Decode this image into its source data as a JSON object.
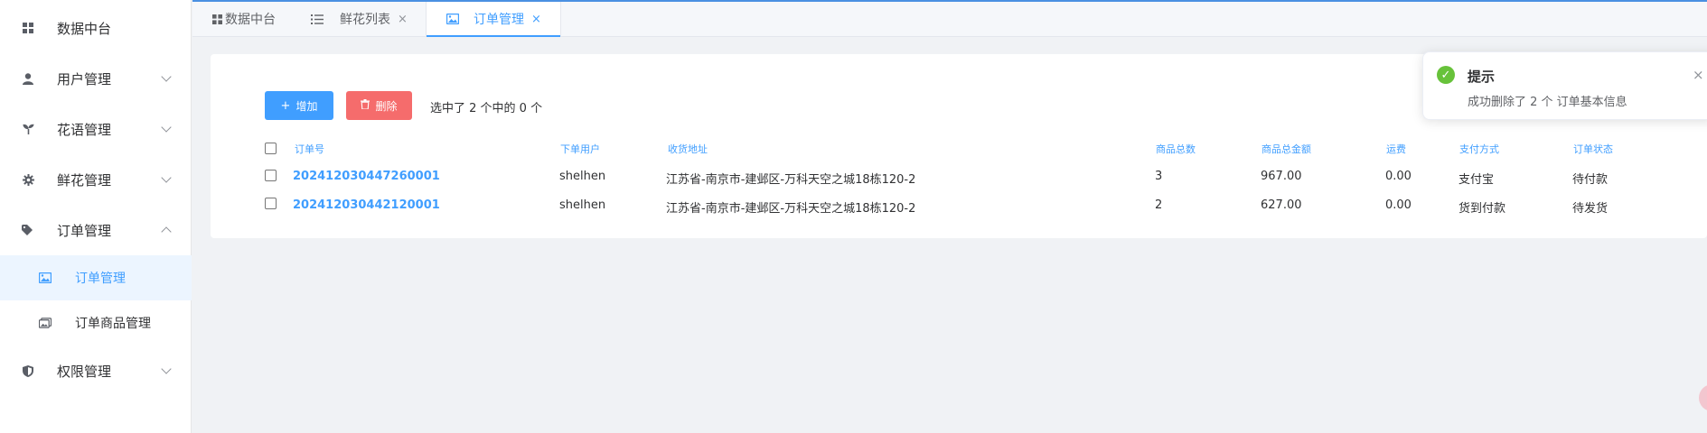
{
  "sidebar": {
    "items": [
      {
        "label": "数据中台",
        "icon": "grid-icon"
      },
      {
        "label": "用户管理",
        "icon": "user-icon"
      },
      {
        "label": "花语管理",
        "icon": "sprout-icon"
      },
      {
        "label": "鲜花管理",
        "icon": "gear-icon"
      },
      {
        "label": "订单管理",
        "icon": "tag-icon"
      },
      {
        "label": "权限管理",
        "icon": "shield-icon"
      }
    ],
    "sub_items": [
      {
        "label": "订单管理",
        "icon": "picture-icon"
      },
      {
        "label": "订单商品管理",
        "icon": "pictures-icon"
      }
    ]
  },
  "tabs": [
    {
      "label": "数据中台",
      "icon": "grid-icon"
    },
    {
      "label": "鲜花列表",
      "icon": "list-icon",
      "close": "×"
    },
    {
      "label": "订单管理",
      "icon": "picture-icon",
      "close": "×"
    }
  ],
  "toolbar": {
    "add_label": "增加",
    "add_icon": "+",
    "delete_label": "删除",
    "selection_info": "选中了 2 个中的 0 个"
  },
  "table": {
    "headers": [
      "订单号",
      "下单用户",
      "收货地址",
      "商品总数",
      "商品总金额",
      "运费",
      "支付方式",
      "订单状态"
    ],
    "rows": [
      [
        "202412030447260001",
        "shelhen",
        "江苏省-南京市-建邺区-万科天空之城18栋120-2",
        "3",
        "967.00",
        "0.00",
        "支付宝",
        "待付款"
      ],
      [
        "202412030442120001",
        "shelhen",
        "江苏省-南京市-建邺区-万科天空之城18栋120-2",
        "2",
        "627.00",
        "0.00",
        "货到付款",
        "待发货"
      ]
    ]
  },
  "notification": {
    "title": "提示",
    "message": "成功删除了 2 个 订单基本信息",
    "close": "×",
    "check": "✓"
  },
  "colors": {
    "primary": "#409eff",
    "danger": "#f56c6c",
    "success": "#67c23a"
  }
}
